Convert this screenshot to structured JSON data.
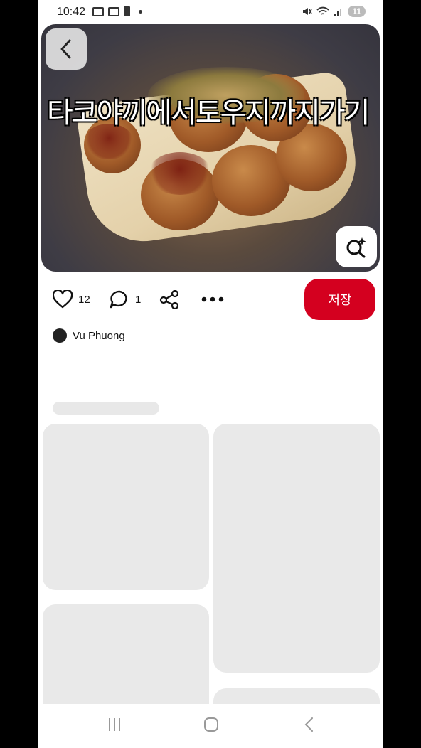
{
  "status": {
    "time": "10:42",
    "notification_count": "11"
  },
  "pin": {
    "overlay_title": "타코야끼에서토우지까지가기",
    "likes": "12",
    "comments": "1",
    "save_label": "저장",
    "author": "Vu Phuong"
  },
  "icons": {
    "back": "chevron-left-icon",
    "lens": "visual-search-icon",
    "like": "heart-icon",
    "comment": "comment-icon",
    "share": "share-icon",
    "more": "more-icon"
  },
  "colors": {
    "accent": "#d4001f",
    "placeholder": "#e9e9e9"
  }
}
